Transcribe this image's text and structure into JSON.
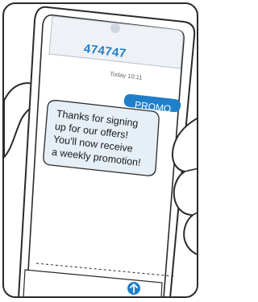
{
  "conversation": {
    "sender": "474747",
    "timestamp": "Today 10:11"
  },
  "messages": {
    "outgoing": "PROMO",
    "incoming_lines": [
      "Thanks for signing",
      "up for our offers!",
      "You'll now receive",
      "a weekly promotion!"
    ]
  },
  "icons": {
    "send": "send-arrow-icon"
  },
  "colors": {
    "accent": "#1f7fc9",
    "incoming_bubble": "#e6eef6",
    "outline": "#2a2a2a"
  }
}
